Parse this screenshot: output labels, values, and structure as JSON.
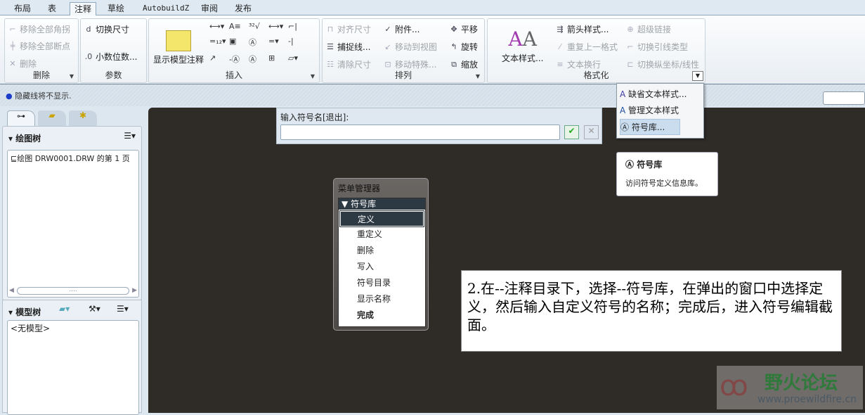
{
  "tabs": [
    "布局",
    "表",
    "注释",
    "草绘",
    "AutobuildZ",
    "审阅",
    "发布"
  ],
  "active_tab": "注释",
  "ribbon": {
    "delete": {
      "label": "删除",
      "items": [
        "移除全部角拐",
        "移除全部断点",
        "删除"
      ]
    },
    "params": {
      "label": "参数",
      "items": [
        "切换尺寸",
        "小数位数..."
      ]
    },
    "insert": {
      "label": "插入",
      "show_model_annotations": "显示模型注释"
    },
    "arrange": {
      "label": "排列",
      "items": [
        "对齐尺寸",
        "捕捉线...",
        "清除尺寸",
        "附件...",
        "移动到视图",
        "移动特殊...",
        "平移",
        "旋转",
        "缩放"
      ]
    },
    "format": {
      "label": "格式化",
      "text_style": "文本样式...",
      "items": [
        "箭头样式...",
        "重复上一格式",
        "文本换行",
        "超级链接",
        "切换引线类型",
        "切换纵坐标/线性"
      ]
    }
  },
  "status_message": "隐藏线将不显示.",
  "left_panel": {
    "drawing_tree": "绘图树",
    "drawing_item": "绘图 DRW0001.DRW 的第 1 页",
    "model_tree": "模型树",
    "no_model": "<无模型>",
    "scroll_thumb": "...."
  },
  "prompt": {
    "label": "输入符号名[退出]:",
    "value": ""
  },
  "format_menu": {
    "items": [
      "缺省文本样式...",
      "管理文本样式",
      "符号库..."
    ]
  },
  "tooltip": {
    "title": "符号库",
    "desc": "访问符号定义信息库。"
  },
  "menu_manager": {
    "title": "菜单管理器",
    "section": "符号库",
    "items": [
      "定义",
      "重定义",
      "删除",
      "写入",
      "符号目录",
      "显示名称",
      "完成"
    ],
    "selected": "定义"
  },
  "annotation": "2.在--注释目录下，选择--符号库，在弹出的窗口中选择定义，然后输入自定义符号的名称；完成后，进入符号编辑截面。",
  "watermark": {
    "name": "野火论坛",
    "url": "www.proewildfire.cn"
  }
}
